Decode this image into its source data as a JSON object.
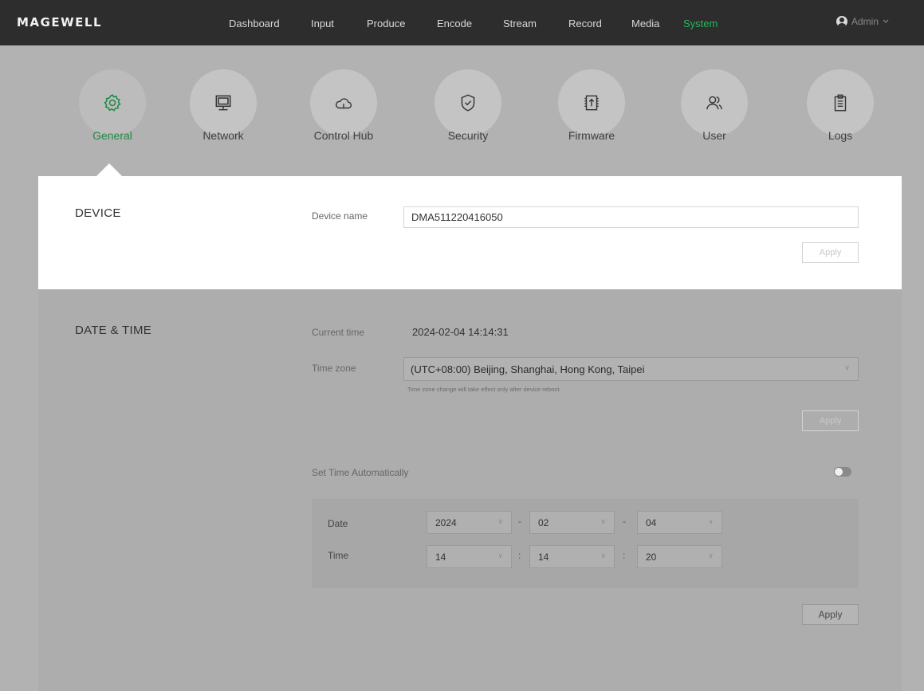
{
  "brand": {
    "logo_text": "MAGEWELL",
    "accent": "#27b85c"
  },
  "nav": {
    "items": [
      {
        "label": "Dashboard",
        "active": false
      },
      {
        "label": "Input",
        "active": false
      },
      {
        "label": "Produce",
        "active": false
      },
      {
        "label": "Encode",
        "active": false
      },
      {
        "label": "Stream",
        "active": false
      },
      {
        "label": "Record",
        "active": false
      },
      {
        "label": "Media",
        "active": false
      },
      {
        "label": "System",
        "active": true
      }
    ],
    "user_label": "Admin",
    "user_icon": "user-icon",
    "user_chevron": "chevron-down-icon"
  },
  "categories": [
    {
      "label": "General",
      "icon": "gear-icon",
      "active": true
    },
    {
      "label": "Network",
      "icon": "monitor-icon",
      "active": false
    },
    {
      "label": "Control Hub",
      "icon": "cloud-icon",
      "active": false
    },
    {
      "label": "Security",
      "icon": "shield-icon",
      "active": false
    },
    {
      "label": "Firmware",
      "icon": "firmware-upload-icon",
      "active": false
    },
    {
      "label": "User",
      "icon": "users-icon",
      "active": false
    },
    {
      "label": "Logs",
      "icon": "clipboard-icon",
      "active": false
    }
  ],
  "device": {
    "title": "DEVICE",
    "name_label": "Device name",
    "name_value": "DMA511220416050",
    "apply_label": "Apply"
  },
  "datetime": {
    "title": "DATE & TIME",
    "current_time_label": "Current time",
    "current_time_value": "2024-02-04 14:14:31",
    "timezone_label": "Time zone",
    "timezone_value": "(UTC+08:00) Beijing, Shanghai, Hong Kong, Taipei",
    "timezone_hint": "Time zone change will take effect only after device reboot.",
    "timezone_apply_label": "Apply",
    "auto_label": "Set Time Automatically",
    "auto_enabled": false,
    "date_label": "Date",
    "date_year": "2024",
    "date_month": "02",
    "date_day": "04",
    "date_sep": "-",
    "time_label": "Time",
    "time_hour": "14",
    "time_minute": "14",
    "time_second": "20",
    "time_sep": ":",
    "apply_label": "Apply"
  }
}
